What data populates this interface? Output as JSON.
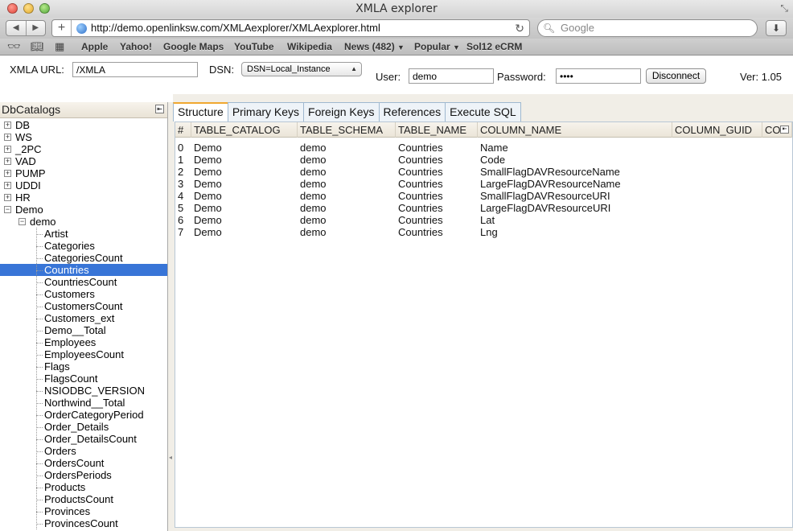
{
  "window": {
    "title": "XMLA explorer"
  },
  "browser": {
    "url": "http://demo.openlinksw.com/XMLAexplorer/XMLAexplorer.html",
    "search_placeholder": "Google",
    "bookmarks": [
      "Apple",
      "Yahoo!",
      "Google Maps",
      "YouTube",
      "Wikipedia",
      "News (482)",
      "Popular",
      "Sol12 eCRM"
    ]
  },
  "header": {
    "xmla_url_label": "XMLA URL:",
    "xmla_url_value": "/XMLA",
    "dsn_label": "DSN:",
    "dsn_value": "DSN=Local_Instance",
    "user_label": "User:",
    "user_value": "demo",
    "password_label": "Password:",
    "password_value": "••••",
    "disconnect_label": "Disconnect",
    "version": "Ver: 1.05"
  },
  "catalog_panel": {
    "title": "DbCatalogs",
    "catalogs": [
      "DB",
      "WS",
      "_2PC",
      "VAD",
      "PUMP",
      "UDDI",
      "HR",
      "Demo"
    ],
    "expanded_catalog": "Demo",
    "schema": "demo",
    "tables": [
      "Artist",
      "Categories",
      "CategoriesCount",
      "Countries",
      "CountriesCount",
      "Customers",
      "CustomersCount",
      "Customers_ext",
      "Demo__Total",
      "Employees",
      "EmployeesCount",
      "Flags",
      "FlagsCount",
      "NSIODBC_VERSION",
      "Northwind__Total",
      "OrderCategoryPeriod",
      "Order_Details",
      "Order_DetailsCount",
      "Orders",
      "OrdersCount",
      "OrdersPeriods",
      "Products",
      "ProductsCount",
      "Provinces",
      "ProvincesCount"
    ],
    "selected_table": "Countries"
  },
  "tabs": [
    "Structure",
    "Primary Keys",
    "Foreign Keys",
    "References",
    "Execute SQL"
  ],
  "active_tab": "Structure",
  "grid": {
    "columns": [
      "#",
      "TABLE_CATALOG",
      "TABLE_SCHEMA",
      "TABLE_NAME",
      "COLUMN_NAME",
      "COLUMN_GUID",
      "CO"
    ],
    "rows": [
      [
        "0",
        "Demo",
        "demo",
        "Countries",
        "Name"
      ],
      [
        "1",
        "Demo",
        "demo",
        "Countries",
        "Code"
      ],
      [
        "2",
        "Demo",
        "demo",
        "Countries",
        "SmallFlagDAVResourceName"
      ],
      [
        "3",
        "Demo",
        "demo",
        "Countries",
        "LargeFlagDAVResourceName"
      ],
      [
        "4",
        "Demo",
        "demo",
        "Countries",
        "SmallFlagDAVResourceURI"
      ],
      [
        "5",
        "Demo",
        "demo",
        "Countries",
        "LargeFlagDAVResourceURI"
      ],
      [
        "6",
        "Demo",
        "demo",
        "Countries",
        "Lat"
      ],
      [
        "7",
        "Demo",
        "demo",
        "Countries",
        "Lng"
      ]
    ]
  }
}
